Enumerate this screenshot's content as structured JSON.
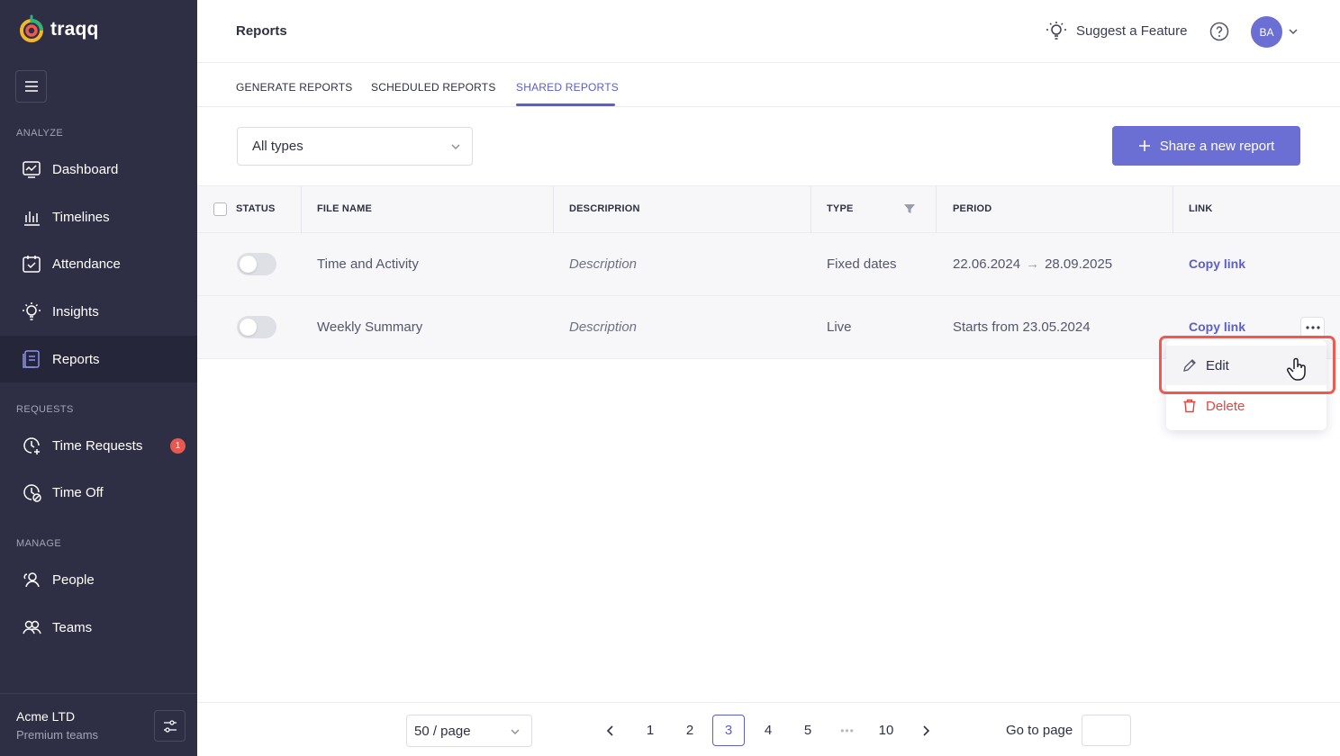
{
  "app": {
    "brand": "traqq"
  },
  "sidebar": {
    "sections": {
      "analyze": "ANALYZE",
      "requests": "REQUESTS",
      "manage": "MANAGE"
    },
    "items": [
      {
        "label": "Dashboard",
        "icon": "dashboard-icon"
      },
      {
        "label": "Timelines",
        "icon": "timelines-icon"
      },
      {
        "label": "Attendance",
        "icon": "calendar-check-icon"
      },
      {
        "label": "Insights",
        "icon": "lightbulb-icon"
      },
      {
        "label": "Reports",
        "icon": "reports-icon",
        "active": true
      },
      {
        "label": "Time Requests",
        "icon": "clock-plus-icon",
        "badge": "1"
      },
      {
        "label": "Time Off",
        "icon": "clock-off-icon"
      },
      {
        "label": "People",
        "icon": "people-icon"
      },
      {
        "label": "Teams",
        "icon": "teams-icon"
      }
    ],
    "org": {
      "name": "Acme LTD",
      "plan": "Premium teams"
    }
  },
  "header": {
    "title": "Reports",
    "suggest": "Suggest a Feature",
    "avatar_initials": "BA"
  },
  "tabs": [
    {
      "label": "GENERATE REPORTS"
    },
    {
      "label": "SCHEDULED REPORTS"
    },
    {
      "label": "SHARED REPORTS",
      "active": true
    }
  ],
  "toolbar": {
    "type_filter": "All types",
    "share_button": "Share a new report"
  },
  "table": {
    "columns": [
      "STATUS",
      "FILE NAME",
      "DESCRIPRION",
      "TYPE",
      "PERIOD",
      "LINK"
    ],
    "rows": [
      {
        "file_name": "Time and Activity",
        "description": "Description",
        "type": "Fixed dates",
        "period_from": "22.06.2024",
        "period_to": "28.09.2025",
        "link": "Copy link",
        "enabled": false
      },
      {
        "file_name": "Weekly Summary",
        "description": "Description",
        "type": "Live",
        "period": "Starts from 23.05.2024",
        "link": "Copy link",
        "enabled": false
      }
    ]
  },
  "menu": {
    "edit": "Edit",
    "delete": "Delete"
  },
  "pagination": {
    "page_size": "50 / page",
    "pages": [
      "1",
      "2",
      "3",
      "4",
      "5",
      "10"
    ],
    "dots": "•••",
    "current": "3",
    "goto_label": "Go to page"
  },
  "colors": {
    "sidebar": "#2e2f45",
    "accent": "#5b5fc7",
    "button": "#6b6fd4",
    "danger": "#e0473f",
    "highlight": "#ef5a50"
  }
}
